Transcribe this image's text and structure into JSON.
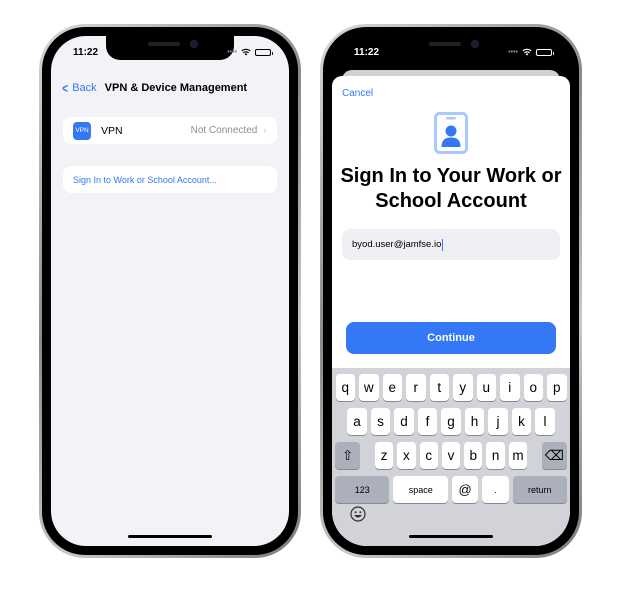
{
  "left_phone": {
    "status_bar": {
      "time": "11:22"
    },
    "nav": {
      "back_label": "Back",
      "title": "VPN & Device Management"
    },
    "vpn_row": {
      "icon_text": "VPN",
      "label": "VPN",
      "status": "Not Connected",
      "chevron": "›"
    },
    "signin_row": {
      "label": "Sign In to Work or School Account..."
    }
  },
  "right_phone": {
    "status_bar": {
      "time": "11:22"
    },
    "sheet": {
      "cancel_label": "Cancel",
      "icon": "person-badge-icon",
      "title": "Sign In to Your Work or School Account",
      "email_value": "byod.user@jamfse.io",
      "continue_label": "Continue"
    },
    "keyboard": {
      "row1": [
        "q",
        "w",
        "e",
        "r",
        "t",
        "y",
        "u",
        "i",
        "o",
        "p"
      ],
      "row2": [
        "a",
        "s",
        "d",
        "f",
        "g",
        "h",
        "j",
        "k",
        "l"
      ],
      "row3": [
        "z",
        "x",
        "c",
        "v",
        "b",
        "n",
        "m"
      ],
      "shift_glyph": "⇧",
      "delete_glyph": "⌫",
      "numbers_label": "123",
      "space_label": "space",
      "at_label": "@",
      "dot_label": ".",
      "return_label": "return",
      "emoji_icon": "emoji-icon"
    }
  },
  "colors": {
    "accent": "#3478f6",
    "grouped_background": "#f2f2f7",
    "secondary_text": "#8e8e93",
    "keyboard_background": "#d1d3d9"
  }
}
